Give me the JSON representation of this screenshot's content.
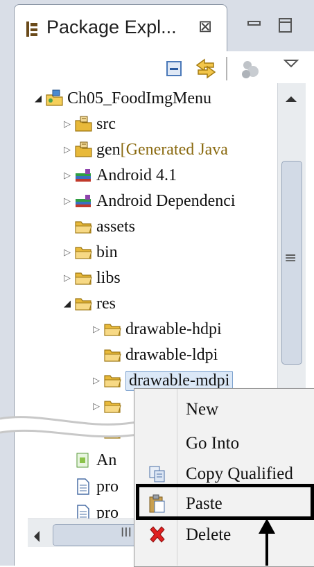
{
  "view": {
    "title": "Package Expl...",
    "close_glyph": "⊠",
    "window_buttons": [
      "minimize-icon",
      "maximize-icon"
    ],
    "toolbar_icons": [
      "collapse-all-icon",
      "link-with-editor-icon",
      "focus-icon",
      "view-menu-icon"
    ]
  },
  "tree": [
    {
      "label": "Ch05_FoodImgMenu",
      "icon": "project-icon",
      "expanded": true,
      "depth": 0
    },
    {
      "label": "src",
      "icon": "source-folder-icon",
      "expanded": false,
      "depth": 1
    },
    {
      "label": "gen",
      "suffix": "[Generated Java",
      "icon": "source-folder-icon",
      "expanded": false,
      "depth": 1
    },
    {
      "label": "Android 4.1",
      "icon": "library-icon",
      "expanded": false,
      "depth": 1
    },
    {
      "label": "Android Dependenci",
      "icon": "library-icon",
      "expanded": false,
      "depth": 1
    },
    {
      "label": "assets",
      "icon": "folder-icon",
      "expanded": null,
      "depth": 1
    },
    {
      "label": "bin",
      "icon": "folder-icon",
      "expanded": false,
      "depth": 1
    },
    {
      "label": "libs",
      "icon": "folder-icon",
      "expanded": false,
      "depth": 1
    },
    {
      "label": "res",
      "icon": "folder-icon",
      "expanded": true,
      "depth": 1
    },
    {
      "label": "drawable-hdpi",
      "icon": "folder-icon",
      "expanded": false,
      "depth": 2
    },
    {
      "label": "drawable-ldpi",
      "icon": "folder-icon",
      "expanded": null,
      "depth": 2
    },
    {
      "label": "drawable-mdpi",
      "icon": "folder-icon",
      "expanded": false,
      "depth": 2,
      "selected": true
    },
    {
      "label": "",
      "icon": "folder-icon",
      "expanded": false,
      "depth": 2
    },
    {
      "label": "",
      "icon": "folder-icon",
      "expanded": true,
      "depth": 2
    },
    {
      "label": "An",
      "icon": "android-manifest-icon",
      "expanded": null,
      "depth": 1
    },
    {
      "label": "pro",
      "icon": "file-icon",
      "expanded": null,
      "depth": 1
    },
    {
      "label": "pro",
      "icon": "file-icon",
      "expanded": null,
      "depth": 1
    }
  ],
  "context_menu": [
    {
      "label": "New",
      "icon": ""
    },
    {
      "label": "Go Into",
      "icon": ""
    },
    {
      "label": "Copy Qualified",
      "icon": "copy-icon"
    },
    {
      "label": "Paste",
      "icon": "paste-icon",
      "highlighted": true
    },
    {
      "label": "Delete",
      "icon": "delete-icon"
    }
  ],
  "scrollbar": {
    "grip": "≡",
    "h_grip": "III"
  },
  "colors": {
    "selection_bg": "#dbe8f7",
    "selection_border": "#7da2ce",
    "folder": "#e8b93a",
    "delete_red": "#e02020"
  }
}
